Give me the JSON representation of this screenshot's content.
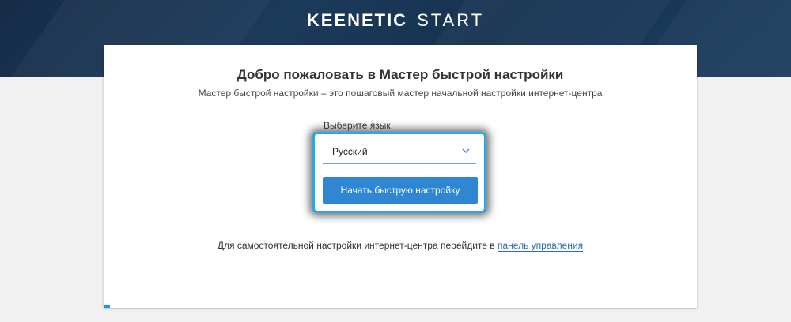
{
  "header": {
    "brand": "KEENETIC",
    "product": "START"
  },
  "wizard": {
    "title": "Добро пожаловать в Мастер быстрой настройки",
    "subtitle": "Мастер быстрой настройки – это пошаговый мастер начальной настройки интернет-центра",
    "language_label": "Выберите язык",
    "language_selected": "Русский",
    "start_button_label": "Начать быструю настройку",
    "footer_text": "Для самостоятельной настройки интернет-центра перейдите в",
    "footer_link_label": "панель управления"
  },
  "icons": {
    "dropdown": "chevron-down-icon"
  },
  "colors": {
    "header_bg": "#1c3a5a",
    "accent": "#2f86d3",
    "highlight": "#2aa8e8",
    "link": "#2a6fa8"
  }
}
